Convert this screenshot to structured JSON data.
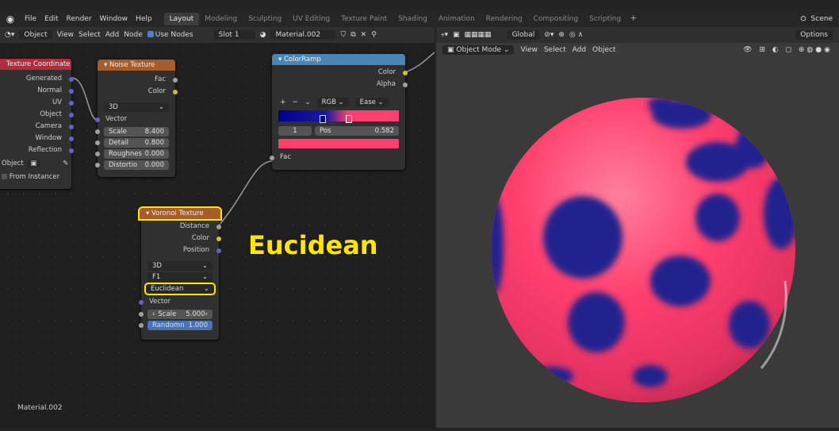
{
  "topbar": {
    "menus": [
      "File",
      "Edit",
      "Render",
      "Window",
      "Help"
    ],
    "tabs": [
      "Layout",
      "Modeling",
      "Sculpting",
      "UV Editing",
      "Texture Paint",
      "Shading",
      "Animation",
      "Rendering",
      "Compositing",
      "Scripting"
    ],
    "active_tab": "Layout",
    "add_tab": "+",
    "scene": "Scene"
  },
  "node_header": {
    "object_type": "Object",
    "view": "View",
    "select": "Select",
    "add": "Add",
    "node": "Node",
    "use_nodes": "Use Nodes",
    "slot": "Slot 1",
    "material": "Material.002"
  },
  "viewport_header": {
    "transform": "Global",
    "options": "Options",
    "mode": "Object Mode",
    "view": "View",
    "select": "Select",
    "add": "Add",
    "object": "Object"
  },
  "texcoord": {
    "title": "Texture Coordinate",
    "outputs": [
      "Generated",
      "Normal",
      "UV",
      "Object",
      "Camera",
      "Window",
      "Reflection"
    ],
    "object_label": "Object",
    "from_instancer": "From Instancer"
  },
  "noise": {
    "title": "Noise Texture",
    "outputs": [
      "Fac",
      "Color"
    ],
    "dim": "3D",
    "vector": "Vector",
    "fields": [
      {
        "label": "Scale",
        "value": "8.400"
      },
      {
        "label": "Detail",
        "value": "0.800"
      },
      {
        "label": "Roughnes",
        "value": "0.000"
      },
      {
        "label": "Distortio",
        "value": "0.000"
      }
    ]
  },
  "colorramp": {
    "title": "ColorRamp",
    "outputs": [
      "Color",
      "Alpha"
    ],
    "plus": "+",
    "minus": "−",
    "mode": "RGB",
    "interp": "Ease",
    "stop_index": "1",
    "pos_label": "Pos",
    "pos_value": "0.582",
    "fac": "Fac"
  },
  "voronoi": {
    "title": "Voronoi Texture",
    "outputs": [
      "Distance",
      "Color",
      "Position"
    ],
    "dim": "3D",
    "feature": "F1",
    "metric": "Euclidean",
    "vector": "Vector",
    "scale_label": "Scale",
    "scale_value": "5.000",
    "random_label": "Randomn",
    "random_value": "1.000"
  },
  "annotation": "Eucidean",
  "material_label": "Material.002",
  "colors": {
    "pink": "#ff3f6e",
    "blue": "#1c1c8c",
    "highlight": "#ffe600"
  }
}
